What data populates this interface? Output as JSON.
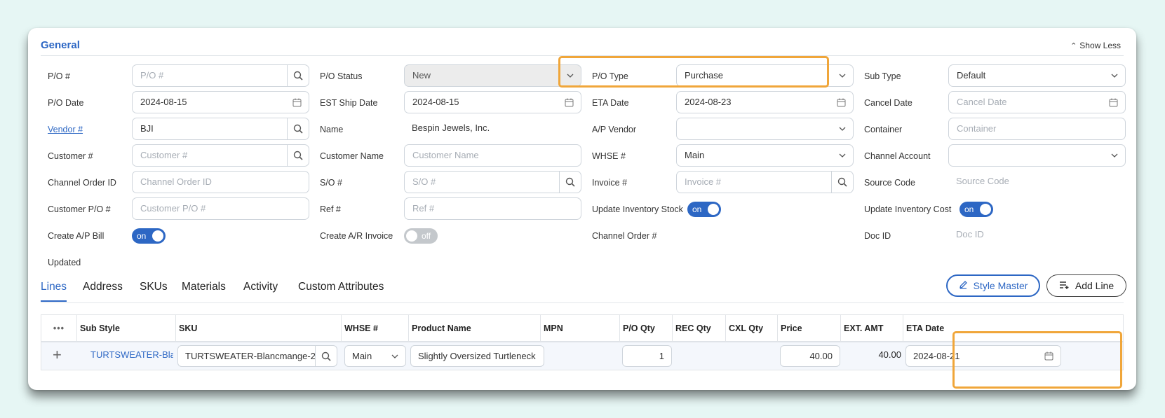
{
  "section": {
    "title": "General",
    "show_less": "Show Less"
  },
  "col1": {
    "po_num": {
      "label": "P/O #",
      "placeholder": "P/O #"
    },
    "po_date": {
      "label": "P/O Date",
      "value": "2024-08-15"
    },
    "vendor": {
      "label": "Vendor #",
      "value": "BJI"
    },
    "customer": {
      "label": "Customer #",
      "placeholder": "Customer #"
    },
    "channel_order_id": {
      "label": "Channel Order ID",
      "placeholder": "Channel Order ID"
    },
    "customer_po": {
      "label": "Customer P/O #",
      "placeholder": "Customer P/O #"
    },
    "create_ap_bill": {
      "label": "Create A/P Bill",
      "state": "on"
    },
    "updated": {
      "label": "Updated"
    }
  },
  "col2": {
    "po_status": {
      "label": "P/O Status",
      "value": "New"
    },
    "est_ship_date": {
      "label": "EST Ship Date",
      "value": "2024-08-15"
    },
    "name": {
      "label": "Name",
      "value": "Bespin Jewels, Inc."
    },
    "customer_name": {
      "label": "Customer Name",
      "placeholder": "Customer Name"
    },
    "so_num": {
      "label": "S/O #",
      "placeholder": "S/O #"
    },
    "ref_num": {
      "label": "Ref #",
      "placeholder": "Ref #"
    },
    "create_ar_invoice": {
      "label": "Create A/R Invoice",
      "state": "off"
    }
  },
  "col3": {
    "po_type": {
      "label": "P/O Type",
      "value": "Purchase"
    },
    "eta_date": {
      "label": "ETA Date",
      "value": "2024-08-23"
    },
    "ap_vendor": {
      "label": "A/P Vendor",
      "value": ""
    },
    "whse": {
      "label": "WHSE #",
      "value": "Main"
    },
    "invoice": {
      "label": "Invoice #",
      "placeholder": "Invoice #"
    },
    "update_inventory_stock": {
      "label": "Update Inventory Stock",
      "state": "on"
    },
    "channel_order": {
      "label": "Channel Order #"
    }
  },
  "col4": {
    "sub_type": {
      "label": "Sub Type",
      "value": "Default"
    },
    "cancel_date": {
      "label": "Cancel Date",
      "placeholder": "Cancel Date"
    },
    "container": {
      "label": "Container",
      "placeholder": "Container"
    },
    "channel_account": {
      "label": "Channel Account",
      "value": ""
    },
    "source_code": {
      "label": "Source Code",
      "placeholder": "Source Code"
    },
    "update_inventory_cost": {
      "label": "Update Inventory Cost",
      "state": "on"
    },
    "doc_id": {
      "label": "Doc ID",
      "placeholder": "Doc ID"
    }
  },
  "tabs": [
    "Lines",
    "Address",
    "SKUs",
    "Materials",
    "Activity",
    "Custom Attributes"
  ],
  "buttons": {
    "style_master": "Style Master",
    "add_line": "Add Line"
  },
  "table": {
    "headers": [
      "Sub Style",
      "SKU",
      "WHSE #",
      "Product Name",
      "MPN",
      "P/O Qty",
      "REC Qty",
      "CXL Qty",
      "Price",
      "EXT. AMT",
      "ETA Date"
    ],
    "row": {
      "sub_style": "TURTSWEATER-Blan",
      "sku": "TURTSWEATER-Blancmange-2",
      "whse": "Main",
      "product_name": "Slightly Oversized Turtleneck",
      "po_qty": "1",
      "price": "40.00",
      "ext_amt": "40.00",
      "eta_date": "2024-08-21"
    }
  },
  "colors": {
    "accent": "#2d67c4",
    "highlight": "#f0a63a",
    "background": "#e6f6f4"
  }
}
